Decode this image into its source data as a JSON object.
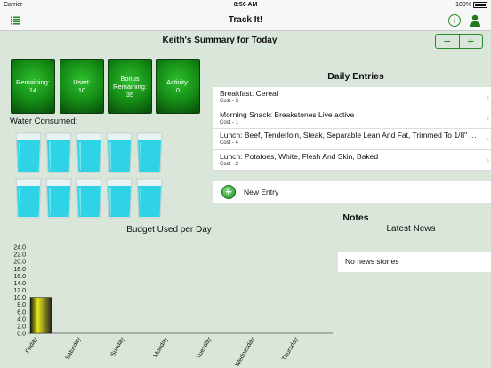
{
  "status_bar": {
    "carrier": "Carrier",
    "time": "8:56 AM",
    "battery": "100%"
  },
  "nav": {
    "title": "Track It!"
  },
  "summary": {
    "title": "Keith's Summary for Today",
    "stepper": {
      "minus": "−",
      "plus": "+"
    },
    "tiles": [
      {
        "label": "Remaining:",
        "value": "14"
      },
      {
        "label": "Used:",
        "value": "10"
      },
      {
        "label1": "Bonus",
        "label2": "Remaining:",
        "value": "35"
      },
      {
        "label": "Activity:",
        "value": "0"
      }
    ]
  },
  "water": {
    "label": "Water Consumed:",
    "glasses": 10,
    "color": "#2ed3e6"
  },
  "daily": {
    "title": "Daily Entries",
    "entries": [
      {
        "name": "Breakfast: Cereal",
        "cost": "Cost - 3"
      },
      {
        "name": "Morning Snack: Breakstones Live active",
        "cost": "Cost - 1"
      },
      {
        "name": "Lunch: Beef, Tenderloin, Steak, Separable Lean And Fat, Trimmed To 1/8\" Fat, All Grades, Cooked, Broiled",
        "cost": "Cost - 4"
      },
      {
        "name": "Lunch: Potatoes, White, Flesh And Skin, Baked",
        "cost": "Cost - 2"
      }
    ],
    "new_entry": "New Entry"
  },
  "notes": {
    "title": "Notes",
    "news_title": "Latest News",
    "news_empty": "No news stories"
  },
  "chart_data": {
    "type": "bar",
    "title": "Budget Used per Day",
    "categories": [
      "Friday",
      "Saturday",
      "Sunday",
      "Monday",
      "Tuesday",
      "Wednesday",
      "Thursday"
    ],
    "values": [
      10,
      0,
      0,
      0,
      0,
      0,
      0
    ],
    "ylim": [
      0,
      24
    ],
    "yticks": [
      "0.0",
      "2.0",
      "4.0",
      "6.0",
      "8.0",
      "10.0",
      "12.0",
      "14.0",
      "16.0",
      "18.0",
      "20.0",
      "22.0",
      "24.0"
    ],
    "bar_color": "#e8e81a"
  }
}
